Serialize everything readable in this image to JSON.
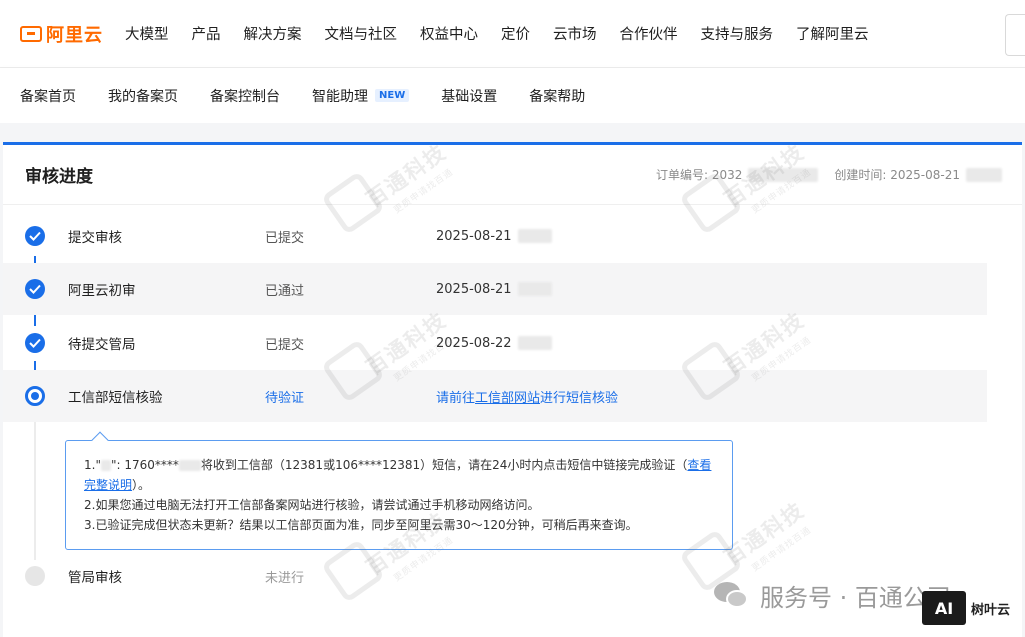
{
  "brand": {
    "name": "阿里云",
    "color": "#ff6a00"
  },
  "nav": [
    "大模型",
    "产品",
    "解决方案",
    "文档与社区",
    "权益中心",
    "定价",
    "云市场",
    "合作伙伴",
    "支持与服务",
    "了解阿里云"
  ],
  "subnav": {
    "items": [
      "备案首页",
      "我的备案页",
      "备案控制台",
      "智能助理",
      "基础设置",
      "备案帮助"
    ],
    "new_badge": "NEW"
  },
  "card": {
    "title": "审核进度",
    "order_label": "订单编号: 2032",
    "created_label": "创建时间: 2025-08-21"
  },
  "steps": [
    {
      "name": "提交审核",
      "status": "已提交",
      "time": "2025-08-21",
      "state": "done"
    },
    {
      "name": "阿里云初审",
      "status": "已通过",
      "time": "2025-08-21",
      "state": "done"
    },
    {
      "name": "待提交管局",
      "status": "已提交",
      "time": "2025-08-22",
      "state": "done"
    },
    {
      "name": "工信部短信核验",
      "status": "待验证",
      "state": "active",
      "action_prefix": "请前往",
      "action_link": "工信部网站",
      "action_suffix": "进行短信核验"
    },
    {
      "name": "管局审核",
      "status": "未进行",
      "state": "pending"
    }
  ],
  "popover": {
    "line1a": "1.\"",
    "line1b": "\": 1760****",
    "line1c": "将收到工信部（12381或106****12381）短信，请在24小时内点击短信中链接完成验证（",
    "line1_link": "查看完整说明",
    "line1_end": "）。",
    "line2": "2.如果您通过电脑无法打开工信部备案网站进行核验，请尝试通过手机移动网络访问。",
    "line3": "3.已验证完成但状态未更新？结果以工信部页面为准，同步至阿里云需30～120分钟，可稍后再来查询。"
  },
  "watermark": {
    "text": "百通科技",
    "sub": "更质申请找百通"
  },
  "footer": {
    "text": "服务号 · 百通公司",
    "ai": "AI",
    "ai_label": "树叶云"
  },
  "colors": {
    "accent": "#1a6ee8",
    "brand": "#ff6a00"
  }
}
